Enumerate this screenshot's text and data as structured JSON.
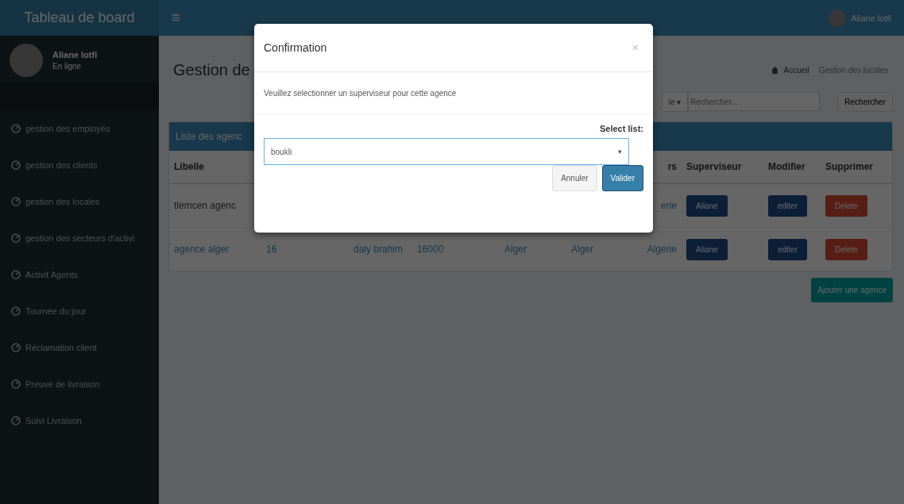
{
  "header": {
    "brand": "Tableau de board",
    "menu_icon": "≡",
    "user": "Aliane lotfi"
  },
  "sidebar": {
    "user": {
      "name": "Aliane lotfi",
      "status": "En ligne"
    },
    "items": [
      {
        "label": "gestion des employés"
      },
      {
        "label": "gestion des clients"
      },
      {
        "label": "gestion des locales"
      },
      {
        "label": "gestion des secteurs d'activi"
      },
      {
        "label": "Activit Agents"
      },
      {
        "label": "Tournée du jour"
      },
      {
        "label": "Réclamation client"
      },
      {
        "label": "Preuve de livraison"
      },
      {
        "label": "Suivi Livraison"
      }
    ]
  },
  "page": {
    "title": "Gestion de",
    "breadcrumb": [
      "Accueil",
      "Gestion des locales"
    ],
    "search": {
      "filter": "le",
      "filter_caret": "▾",
      "placeholder": "Rechercher...",
      "button": "Rechercher"
    },
    "panel_title": "Liste des agenc",
    "columns": [
      "Libelle",
      null,
      null,
      null,
      null,
      null,
      "rs",
      "Superviseur",
      "Modifier",
      "Supprimer"
    ],
    "rows": [
      {
        "cells": [
          "tlemcen agenc",
          null,
          null,
          null,
          null,
          null,
          "erie"
        ],
        "supervisor": "Aliane",
        "edit": "editer",
        "delete": "Delete"
      },
      {
        "cells": [
          "agence alger",
          "16",
          "daly brahim",
          "16000",
          "Alger",
          "Alger",
          "Algerie"
        ],
        "supervisor": "Aliane",
        "edit": "editer",
        "delete": "Delete"
      }
    ],
    "add_button": "Ajouter une agence"
  },
  "modal": {
    "title": "Confirmation",
    "close": "×",
    "message": "Veuillez selectionner un superviseur pour cette agence",
    "select_label": "Select list:",
    "select_value": "boukli",
    "select_caret": "▾",
    "buttons": [
      {
        "label": "Annuler",
        "kind": "default"
      },
      {
        "label": "Valider",
        "kind": "primary"
      }
    ]
  }
}
